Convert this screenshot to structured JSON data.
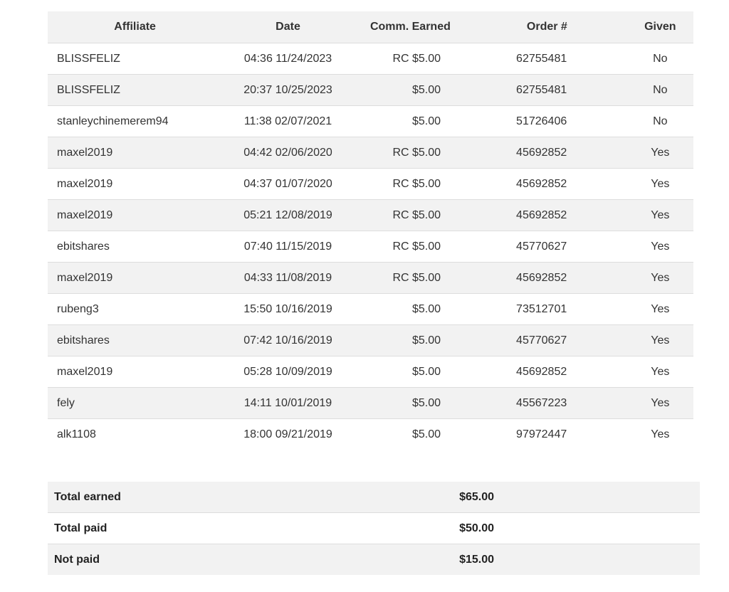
{
  "history": {
    "headers": {
      "affiliate": "Affiliate",
      "date": "Date",
      "comm": "Comm. Earned",
      "order": "Order #",
      "given": "Given"
    },
    "rows": [
      {
        "affiliate": "BLISSFELIZ",
        "date": "04:36 11/24/2023",
        "comm": "RC $5.00",
        "order": "62755481",
        "given": "No"
      },
      {
        "affiliate": "BLISSFELIZ",
        "date": "20:37 10/25/2023",
        "comm": "$5.00",
        "order": "62755481",
        "given": "No"
      },
      {
        "affiliate": "stanleychinemerem94",
        "date": "11:38 02/07/2021",
        "comm": "$5.00",
        "order": "51726406",
        "given": "No"
      },
      {
        "affiliate": "maxel2019",
        "date": "04:42 02/06/2020",
        "comm": "RC $5.00",
        "order": "45692852",
        "given": "Yes"
      },
      {
        "affiliate": "maxel2019",
        "date": "04:37 01/07/2020",
        "comm": "RC $5.00",
        "order": "45692852",
        "given": "Yes"
      },
      {
        "affiliate": "maxel2019",
        "date": "05:21 12/08/2019",
        "comm": "RC $5.00",
        "order": "45692852",
        "given": "Yes"
      },
      {
        "affiliate": "ebitshares",
        "date": "07:40 11/15/2019",
        "comm": "RC $5.00",
        "order": "45770627",
        "given": "Yes"
      },
      {
        "affiliate": "maxel2019",
        "date": "04:33 11/08/2019",
        "comm": "RC $5.00",
        "order": "45692852",
        "given": "Yes"
      },
      {
        "affiliate": "rubeng3",
        "date": "15:50 10/16/2019",
        "comm": "$5.00",
        "order": "73512701",
        "given": "Yes"
      },
      {
        "affiliate": "ebitshares",
        "date": "07:42 10/16/2019",
        "comm": "$5.00",
        "order": "45770627",
        "given": "Yes"
      },
      {
        "affiliate": "maxel2019",
        "date": "05:28 10/09/2019",
        "comm": "$5.00",
        "order": "45692852",
        "given": "Yes"
      },
      {
        "affiliate": "fely",
        "date": "14:11 10/01/2019",
        "comm": "$5.00",
        "order": "45567223",
        "given": "Yes"
      },
      {
        "affiliate": "alk1108",
        "date": "18:00 09/21/2019",
        "comm": "$5.00",
        "order": "97972447",
        "given": "Yes"
      }
    ]
  },
  "totals": [
    {
      "label": "Total earned",
      "value": "$65.00"
    },
    {
      "label": "Total paid",
      "value": "$50.00"
    },
    {
      "label": "Not paid",
      "value": "$15.00"
    }
  ],
  "colors": {
    "stripe": "#f2f2f2",
    "border": "#dddddd",
    "text": "#333333"
  }
}
